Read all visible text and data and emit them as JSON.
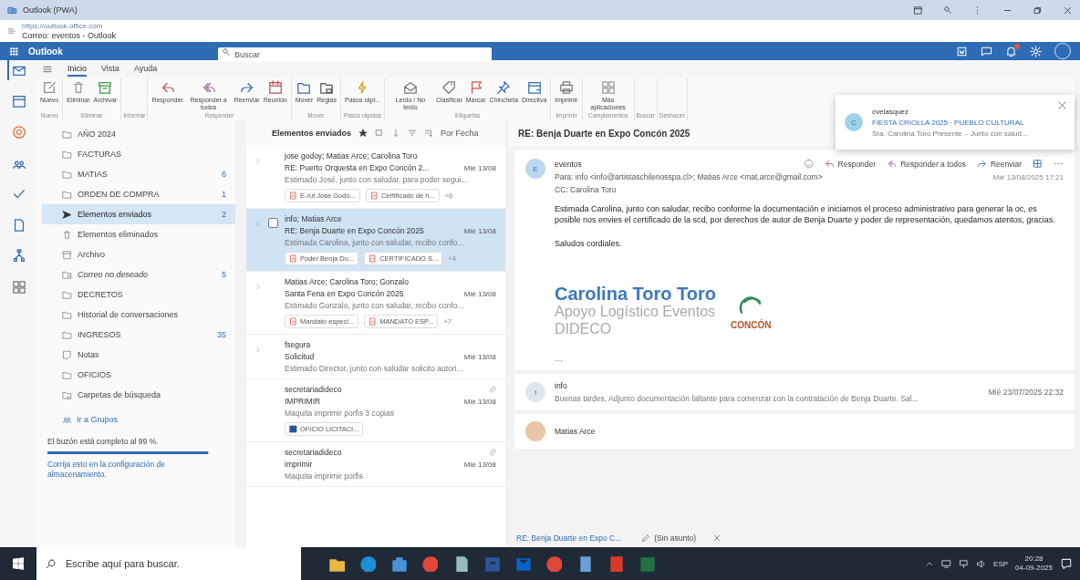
{
  "window": {
    "title": "Outlook (PWA)"
  },
  "address": {
    "url": "https://outlook.office.com",
    "page_title": "Correo: eventos - Outlook"
  },
  "header": {
    "app_name": "Outlook",
    "search": {
      "placeholder": "Buscar"
    },
    "notifications_unread": true
  },
  "ribbon": {
    "tabs": [
      {
        "label": "Inicio",
        "selected": true
      },
      {
        "label": "Vista",
        "selected": false
      },
      {
        "label": "Ayuda",
        "selected": false
      }
    ],
    "groups": [
      {
        "label": "Nuevo",
        "buttons": [
          {
            "label": "Nuevo",
            "kind": "new"
          }
        ]
      },
      {
        "label": "Eliminar",
        "buttons": [
          {
            "label": "Eliminar",
            "kind": "delete"
          },
          {
            "label": "Archivar",
            "kind": "archive"
          }
        ]
      },
      {
        "label": "Informar"
      },
      {
        "label": "Responder",
        "buttons": [
          {
            "label": "Responder",
            "kind": "reply"
          },
          {
            "label": "Responder a todos",
            "kind": "reply_all"
          },
          {
            "label": "Reenviar",
            "kind": "forward"
          },
          {
            "label": "Reunión",
            "kind": "meeting"
          }
        ]
      },
      {
        "label": "Mover",
        "buttons": [
          {
            "label": "Mover",
            "kind": "move"
          },
          {
            "label": "Reglas",
            "kind": "rules"
          }
        ]
      },
      {
        "label": "Pasos rápidos",
        "buttons": [
          {
            "label": "Pasos rápi...",
            "kind": "quick"
          }
        ]
      },
      {
        "label": "Etiquetas",
        "buttons": [
          {
            "label": "Leído / No leído",
            "kind": "read"
          },
          {
            "label": "Clasificar",
            "kind": "tag"
          },
          {
            "label": "Marcar",
            "kind": "flag"
          },
          {
            "label": "Chincheta",
            "kind": "pin"
          },
          {
            "label": "Directiva",
            "kind": "policy"
          }
        ]
      },
      {
        "label": "Imprimir",
        "buttons": [
          {
            "label": "Imprimir",
            "kind": "print"
          }
        ]
      },
      {
        "label": "Complementos",
        "buttons": [
          {
            "label": "Más aplicaciones",
            "kind": "apps"
          }
        ]
      },
      {
        "label": "Buscar"
      },
      {
        "label": "Deshacer"
      }
    ]
  },
  "notification": {
    "sender": "cvelasquez",
    "initial": "C",
    "subject": "FIESTA CRIOLLA 2025 · PUEBLO CULTURAL",
    "preview": "Sra. Carolina Toro Presente .- Junto con salud..."
  },
  "rail": [
    {
      "kind": "mail",
      "selected": true
    },
    {
      "kind": "calendar",
      "selected": false
    },
    {
      "kind": "copilot",
      "selected": false
    },
    {
      "kind": "people",
      "selected": false
    },
    {
      "kind": "todo",
      "selected": false
    },
    {
      "kind": "files",
      "selected": false
    },
    {
      "kind": "org",
      "selected": false
    },
    {
      "kind": "apps",
      "selected": false
    }
  ],
  "folders": [
    {
      "name": "AÑO 2024",
      "kind": "folder",
      "selected": false
    },
    {
      "name": "FACTURAS",
      "kind": "folder",
      "selected": false
    },
    {
      "name": "MATIAS",
      "count": "6",
      "kind": "folder",
      "selected": false
    },
    {
      "name": "ORDEN DE COMPRA",
      "count": "1",
      "kind": "folder",
      "selected": false
    },
    {
      "name": "Elementos enviados",
      "count": "2",
      "kind": "sent",
      "selected": true
    },
    {
      "name": "Elementos eliminados",
      "kind": "trash",
      "selected": false
    },
    {
      "name": "Archivo",
      "kind": "archive",
      "selected": false
    },
    {
      "name": "Correo no deseado",
      "count": "5",
      "kind": "junk",
      "selected": false
    },
    {
      "name": "DECRETOS",
      "kind": "folder",
      "selected": false
    },
    {
      "name": "Historial de conversaciones",
      "kind": "folder",
      "selected": false
    },
    {
      "name": "INGRESOS",
      "count": "35",
      "kind": "folder",
      "selected": false
    },
    {
      "name": "Notas",
      "kind": "notes",
      "selected": false
    },
    {
      "name": "OFICIOS",
      "kind": "folder",
      "selected": false
    },
    {
      "name": "Carpetas de búsqueda",
      "kind": "search",
      "selected": false
    }
  ],
  "groups_link": "Ir a Grupos",
  "storage": {
    "text": "El buzón está completo al 99 %.",
    "level": 0.99,
    "link": "Corrija esto en la configuración de almacenamiento."
  },
  "message_list": {
    "folder": "Elementos enviados",
    "sort": "Por Fecha",
    "messages": [
      {
        "from": "jose godoy; Matias Arce; Carolina Toro",
        "subject": "RE: Puerto Orquesta en Expo Concón 2...",
        "date": "Mié 13/08",
        "preview": "Estimado José, junto con saludar, para poder segui...",
        "expandable": true,
        "has_attachment": false,
        "selected": false,
        "attachments": [
          {
            "name": "E-rut Jose Godo...",
            "kind": "pdf"
          },
          {
            "name": "Certificado de h...",
            "kind": "pdf"
          }
        ],
        "more": "+6"
      },
      {
        "from": "info; Matias Arce",
        "subject": "RE: Benja Duarte en Expo Concón 2025",
        "date": "Mié 13/08",
        "preview": "Estimada Carolina, junto con saludar, recibo confo...",
        "expandable": true,
        "has_attachment": false,
        "selected": true,
        "attachments": [
          {
            "name": "Poder Benja Du...",
            "kind": "pdf"
          },
          {
            "name": "CERTIFICADO S...",
            "kind": "pdf"
          }
        ],
        "more": "+4"
      },
      {
        "from": "Matias Arce; Carolina Toro; Gonzalo",
        "subject": "Santa Fena en Expo Concón 2025",
        "date": "Mié 13/08",
        "preview": "Estimado Gonzalo, junto con saludar, recibo confo...",
        "expandable": true,
        "has_attachment": false,
        "selected": false,
        "attachments": [
          {
            "name": "Mandato especi...",
            "kind": "pdf"
          },
          {
            "name": "MANDATO ESP...",
            "kind": "pdf"
          }
        ],
        "more": "+7"
      },
      {
        "from": "fsegura",
        "subject": "Solicitud",
        "date": "Mié 13/08",
        "preview": "Estimado Director, junto con saludar solicito autori...",
        "expandable": true,
        "has_attachment": false,
        "selected": false
      },
      {
        "from": "secretariadideco",
        "subject": "IMPRIMIR",
        "date": "Mié 13/08",
        "preview": "Maquita imprimir porfis 3 copias",
        "expandable": false,
        "has_attachment": true,
        "selected": false,
        "attachments": [
          {
            "name": "OFICIO LICITACI...",
            "kind": "word"
          }
        ]
      },
      {
        "from": "secretariadideco",
        "subject": "imprimir",
        "date": "Mié 13/08",
        "preview": "Maquita imprimir porfis",
        "expandable": false,
        "has_attachment": true,
        "selected": false
      }
    ]
  },
  "reading": {
    "subject": "RE: Benja Duarte en Expo Concón 2025",
    "message": {
      "sender": "eventos",
      "initial": "E",
      "actions": [
        {
          "label": "Responder",
          "kind": "reply"
        },
        {
          "label": "Responder a todos",
          "kind": "reply_all"
        },
        {
          "label": "Reenviar",
          "kind": "forward"
        }
      ],
      "to": "Para:  info <info@artistaschilenosspa.cl>;  Matias Arce <mat.arce@gmail.com>",
      "date": "Mié 13/08/2025 17:21",
      "cc": "CC:  Carolina Toro",
      "body": [
        "Estimada Carolina, junto con saludar, recibo conforme la documentación e iniciamos el proceso administrativo para generar la oc, es posible nos envies el certificado de la scd, por derechos de autor de Benja Duarte y poder de representación, quedamos atentos, gracias.",
        "Saludos cordiales."
      ],
      "signature": {
        "name": "Carolina Toro Toro",
        "role": "Apoyo Logístico Eventos",
        "unit": "DIDECO",
        "logo_text": "CONCÓN"
      },
      "trimmed": "···"
    },
    "earlier": [
      {
        "sender": "info",
        "initial": "I",
        "preview": "Buenas tardes, Adjunto documentación faltante para comenzar con la contratación de Benja Duarte. Sal...",
        "date": "Mié 23/07/2025 22:32"
      },
      {
        "sender": "Matias Arce"
      }
    ]
  },
  "drafts": [
    {
      "label": "RE: Benja Duarte en Expo C...",
      "kind": "reply"
    },
    {
      "label": "(Sin asunto)",
      "kind": "draft"
    }
  ],
  "taskbar": {
    "search": {
      "placeholder": "Escribe aquí para buscar."
    },
    "apps": [
      {
        "kind": "explorer"
      },
      {
        "kind": "edge"
      },
      {
        "kind": "store"
      },
      {
        "kind": "chrome"
      },
      {
        "kind": "files"
      },
      {
        "kind": "word"
      },
      {
        "kind": "outlook"
      },
      {
        "kind": "chrome"
      },
      {
        "kind": "notepad"
      },
      {
        "kind": "pdf"
      },
      {
        "kind": "excel"
      }
    ],
    "language": "ESP",
    "time": "20:28",
    "date": "04-09-2025"
  }
}
